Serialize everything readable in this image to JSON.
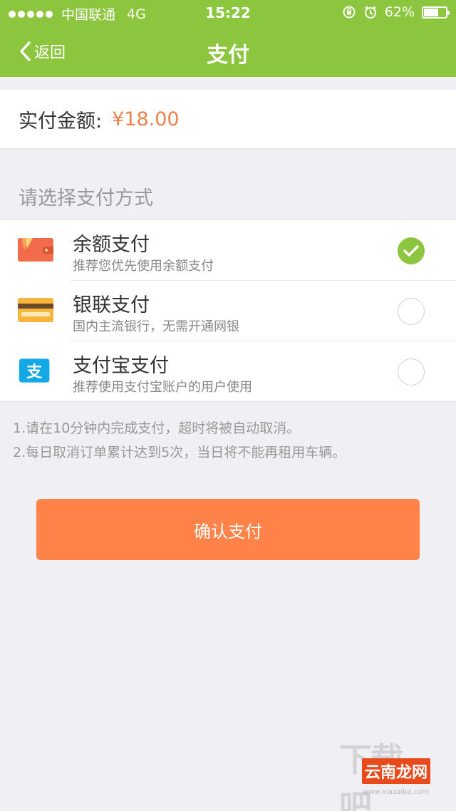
{
  "status_bar": {
    "carrier": "中国联通",
    "network": "4G",
    "time": "15:22",
    "battery": "62%",
    "battery_level": 0.62
  },
  "nav": {
    "back_label": "返回",
    "title": "支付"
  },
  "amount": {
    "label": "实付金额:",
    "value": "¥18.00"
  },
  "payment_section_title": "请选择支付方式",
  "methods": [
    {
      "title": "余额支付",
      "subtitle": "推荐您优先使用余额支付",
      "icon": "wallet-icon",
      "selected": true
    },
    {
      "title": "银联支付",
      "subtitle": "国内主流银行，无需开通网银",
      "icon": "bank-card-icon",
      "selected": false
    },
    {
      "title": "支付宝支付",
      "subtitle": "推荐使用支付宝账户的用户使用",
      "icon": "alipay-icon",
      "selected": false
    }
  ],
  "notes": [
    "1.请在10分钟内完成支付，超时将被自动取消。",
    "2.每日取消订单累计达到5次，当日将不能再租用车辆。"
  ],
  "confirm_label": "确认支付",
  "watermark": {
    "text": "下载吧",
    "tag": "云南龙网",
    "url": "www.xiazaiba.com"
  },
  "colors": {
    "header": "#8cc63f",
    "accent_orange": "#ff8249",
    "price": "#f0804a",
    "check_green": "#8cc63f"
  }
}
